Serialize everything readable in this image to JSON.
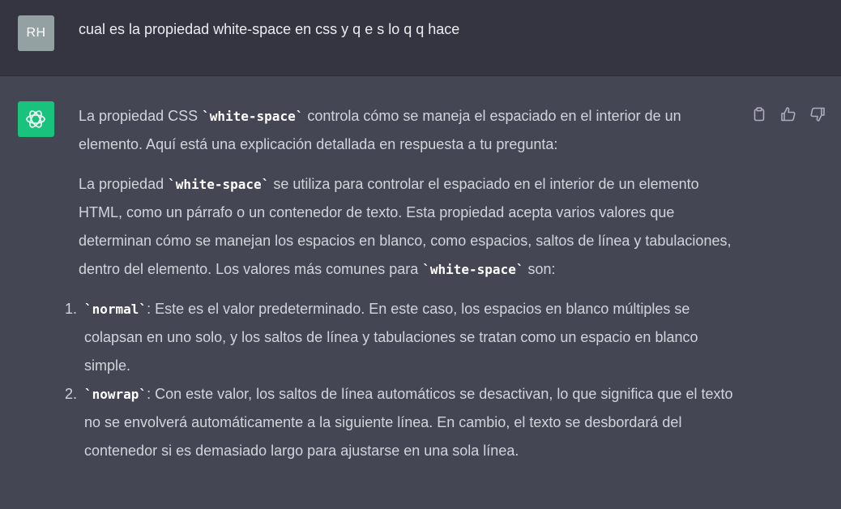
{
  "user": {
    "initials": "RH",
    "message": "cual es la propiedad white-space en css y q e s lo q q hace"
  },
  "assistant": {
    "p1_a": "La propiedad CSS ",
    "p1_code": "`white-space`",
    "p1_b": " controla cómo se maneja el espaciado en el interior de un elemento. Aquí está una explicación detallada en respuesta a tu pregunta:",
    "p2_a": "La propiedad ",
    "p2_code": "`white-space`",
    "p2_b": " se utiliza para controlar el espaciado en el interior de un elemento HTML, como un párrafo o un contenedor de texto. Esta propiedad acepta varios valores que determinan cómo se manejan los espacios en blanco, como espacios, saltos de línea y tabulaciones, dentro del elemento. Los valores más comunes para ",
    "p2_code2": "`white-space`",
    "p2_c": " son:",
    "list": [
      {
        "num": "1.",
        "code": "`normal`",
        "text": ": Este es el valor predeterminado. En este caso, los espacios en blanco múltiples se colapsan en uno solo, y los saltos de línea y tabulaciones se tratan como un espacio en blanco simple."
      },
      {
        "num": "2.",
        "code": "`nowrap`",
        "text": ": Con este valor, los saltos de línea automáticos se desactivan, lo que significa que el texto no se envolverá automáticamente a la siguiente línea. En cambio, el texto se desbordará del contenedor si es demasiado largo para ajustarse en una sola línea."
      }
    ]
  },
  "actions": {
    "copy_icon": "clipboard-icon",
    "like_icon": "thumbs-up-icon",
    "dislike_icon": "thumbs-down-icon"
  },
  "colors": {
    "user_bg": "#343541",
    "assistant_bg": "#444654",
    "bot_avatar": "#19c37d",
    "user_avatar": "#94a1a3"
  }
}
